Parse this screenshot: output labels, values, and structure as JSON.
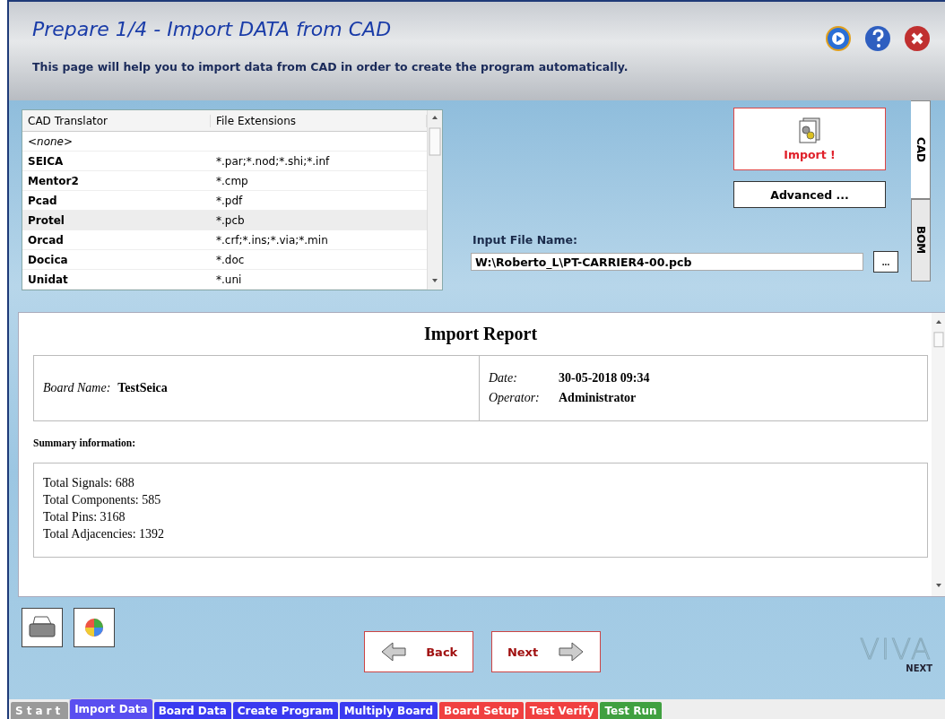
{
  "window": {
    "title": "Prepare 1/4 - Import DATA from CAD",
    "subtitle": "This page will help you to import data from CAD in order to create the program automatically."
  },
  "translators": {
    "columns": [
      "CAD Translator",
      "File Extensions"
    ],
    "rows": [
      {
        "name": "<none>",
        "ext": "",
        "kind": "none",
        "selected": false
      },
      {
        "name": "SEICA",
        "ext": "*.par;*.nod;*.shi;*.inf",
        "kind": "item",
        "selected": false
      },
      {
        "name": "Mentor2",
        "ext": "*.cmp",
        "kind": "item",
        "selected": false
      },
      {
        "name": "Pcad",
        "ext": "*.pdf",
        "kind": "item",
        "selected": false
      },
      {
        "name": "Protel",
        "ext": "*.pcb",
        "kind": "item",
        "selected": true
      },
      {
        "name": "Orcad",
        "ext": "*.crf;*.ins;*.via;*.min",
        "kind": "item",
        "selected": false
      },
      {
        "name": "Docica",
        "ext": "*.doc",
        "kind": "item",
        "selected": false
      },
      {
        "name": "Unidat",
        "ext": "*.uni",
        "kind": "item",
        "selected": false
      }
    ]
  },
  "import_button": "Import !",
  "advanced_button": "Advanced ...",
  "input_file": {
    "label": "Input File Name:",
    "value": "W:\\Roberto_L\\PT-CARRIER4-00.pcb",
    "browse": "..."
  },
  "side_tabs": [
    {
      "label": "CAD",
      "selected": true
    },
    {
      "label": "BOM",
      "selected": false
    }
  ],
  "report": {
    "title": "Import Report",
    "board_label": "Board Name:",
    "board_value": "TestSeica",
    "date_label": "Date:",
    "date_value": "30-05-2018 09:34",
    "operator_label": "Operator:",
    "operator_value": "Administrator",
    "summary_heading": "Summary information:",
    "summary": [
      "Total Signals: 688",
      "Total Components: 585",
      "Total Pins: 3168",
      "Total Adjacencies: 1392"
    ]
  },
  "nav": {
    "back": "Back",
    "next": "Next"
  },
  "logo": {
    "name": "VIVA",
    "tagline": "NEXT"
  },
  "steps": [
    {
      "label": "Start",
      "color": "#9a9a9a",
      "selected": false
    },
    {
      "label": "Import Data",
      "color": "#5a4ff0",
      "selected": true
    },
    {
      "label": "Board Data",
      "color": "#3a3af0",
      "selected": false
    },
    {
      "label": "Create Program",
      "color": "#3a3af0",
      "selected": false
    },
    {
      "label": "Multiply Board",
      "color": "#3a3af0",
      "selected": false
    },
    {
      "label": "Board Setup",
      "color": "#f04040",
      "selected": false
    },
    {
      "label": "Test Verify",
      "color": "#f04040",
      "selected": false
    },
    {
      "label": "Test Run",
      "color": "#40a040",
      "selected": false
    }
  ]
}
